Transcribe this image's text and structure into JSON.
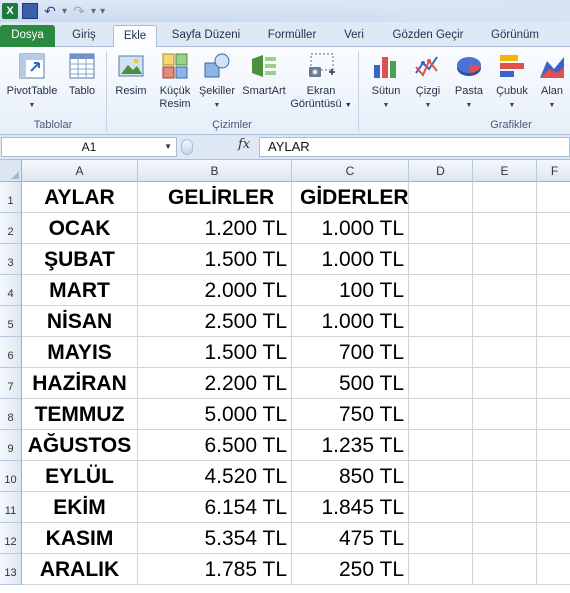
{
  "quick_access": {
    "app_logo": "X",
    "undo_symbol": "↶",
    "redo_symbol": "↷",
    "more_symbol": "▾"
  },
  "tabs": [
    "Dosya",
    "Giriş",
    "Ekle",
    "Sayfa Düzeni",
    "Formüller",
    "Veri",
    "Gözden Geçir",
    "Görünüm"
  ],
  "active_tab": "Ekle",
  "ribbon": {
    "tables": {
      "label": "Tablolar",
      "pivot": "PivotTable",
      "table": "Tablo"
    },
    "illustrations": {
      "label": "Çizimler",
      "picture": "Resim",
      "clipart_1": "Küçük",
      "clipart_2": "Resim",
      "shapes": "Şekiller",
      "smartart": "SmartArt",
      "screenshot_1": "Ekran",
      "screenshot_2": "Görüntüsü"
    },
    "charts": {
      "label": "Grafikler",
      "column": "Sütun",
      "line": "Çizgi",
      "pie": "Pasta",
      "bar": "Çubuk",
      "area": "Alan"
    }
  },
  "formula_bar": {
    "name_box": "A1",
    "fx": "fx",
    "content": "AYLAR"
  },
  "columns": [
    "A",
    "B",
    "C",
    "D",
    "E",
    "F"
  ],
  "sheet": {
    "headers": [
      "AYLAR",
      "GELİRLER",
      "GİDERLER"
    ],
    "rows": [
      [
        "OCAK",
        "1.200 TL",
        "1.000 TL"
      ],
      [
        "ŞUBAT",
        "1.500 TL",
        "1.000 TL"
      ],
      [
        "MART",
        "2.000 TL",
        "100 TL"
      ],
      [
        "NİSAN",
        "2.500 TL",
        "1.000 TL"
      ],
      [
        "MAYIS",
        "1.500 TL",
        "700 TL"
      ],
      [
        "HAZİRAN",
        "2.200 TL",
        "500 TL"
      ],
      [
        "TEMMUZ",
        "5.000 TL",
        "750 TL"
      ],
      [
        "AĞUSTOS",
        "6.500 TL",
        "1.235 TL"
      ],
      [
        "EYLÜL",
        "4.520 TL",
        "850 TL"
      ],
      [
        "EKİM",
        "6.154 TL",
        "1.845 TL"
      ],
      [
        "KASIM",
        "5.354 TL",
        "475 TL"
      ],
      [
        "ARALIK",
        "1.785 TL",
        "250 TL"
      ]
    ],
    "row_numbers": [
      "1",
      "2",
      "3",
      "4",
      "5",
      "6",
      "7",
      "8",
      "9",
      "10",
      "11",
      "12",
      "13"
    ]
  },
  "colors": {
    "file_tab": "#2a8a3f",
    "ribbon_bg": "#e6eef9",
    "header_bg": "#dce6f2"
  }
}
